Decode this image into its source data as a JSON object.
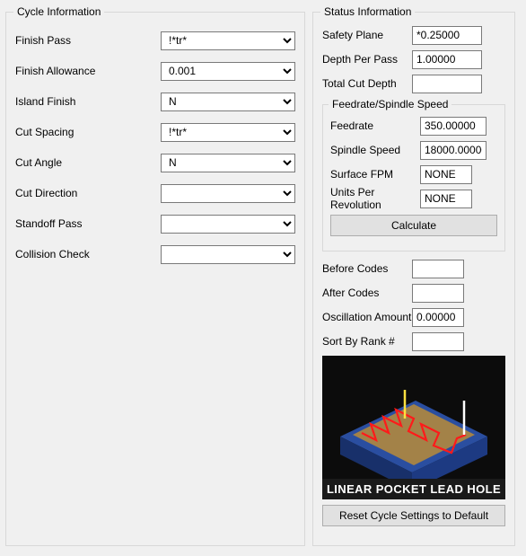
{
  "cycle": {
    "legend": "Cycle Information",
    "fields": {
      "finish_pass": {
        "label": "Finish Pass",
        "value": "!*tr*"
      },
      "finish_allowance": {
        "label": "Finish Allowance",
        "value": "0.001"
      },
      "island_finish": {
        "label": "Island Finish",
        "value": "N"
      },
      "cut_spacing": {
        "label": "Cut Spacing",
        "value": "!*tr*"
      },
      "cut_angle": {
        "label": "Cut Angle",
        "value": "N"
      },
      "cut_direction": {
        "label": "Cut Direction",
        "value": ""
      },
      "standoff_pass": {
        "label": "Standoff Pass",
        "value": ""
      },
      "collision_check": {
        "label": "Collision Check",
        "value": ""
      }
    }
  },
  "status": {
    "legend": "Status Information",
    "fields": {
      "safety_plane": {
        "label": "Safety Plane",
        "value": "*0.25000"
      },
      "depth_per_pass": {
        "label": "Depth Per Pass",
        "value": "1.00000"
      },
      "total_cut_depth": {
        "label": "Total Cut Depth",
        "value": ""
      }
    },
    "feedrate": {
      "legend": "Feedrate/Spindle Speed",
      "fields": {
        "feedrate": {
          "label": "Feedrate",
          "value": "350.00000"
        },
        "spindle_speed": {
          "label": "Spindle Speed",
          "value": "18000.00000"
        },
        "surface_fpm": {
          "label": "Surface FPM",
          "value": "NONE"
        },
        "upr": {
          "label": "Units Per Revolution",
          "value": "NONE"
        }
      },
      "calc_label": "Calculate"
    },
    "extras": {
      "before_codes": {
        "label": "Before Codes",
        "value": ""
      },
      "after_codes": {
        "label": "After Codes",
        "value": ""
      },
      "osc_amount": {
        "label": "Oscillation Amount",
        "value": "0.00000"
      },
      "sort_rank": {
        "label": "Sort By Rank #",
        "value": ""
      }
    },
    "illustration_caption": "LINEAR POCKET LEAD HOLE",
    "reset_label": "Reset Cycle Settings to Default"
  }
}
